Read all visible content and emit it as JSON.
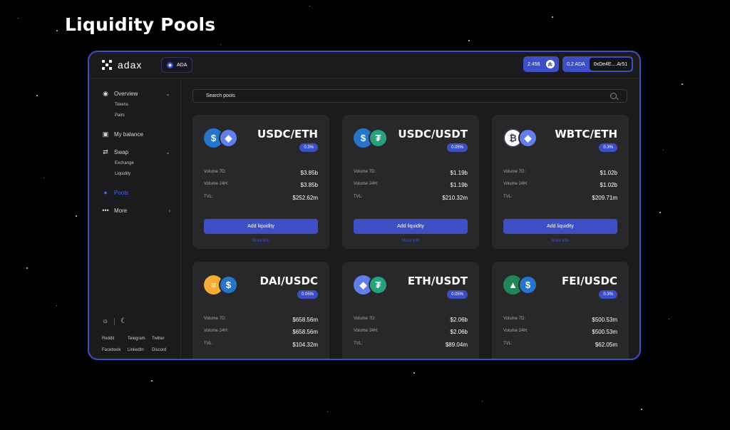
{
  "page": {
    "title": "Liquidity Pools"
  },
  "header": {
    "logo": "adax",
    "network_chip": "ADA",
    "balance": "2.456",
    "wallet_balance": "0.2 ADA",
    "wallet_address": "0xDe4E....Ar51"
  },
  "sidebar": {
    "overview": "Overview",
    "tokens": "Tokens",
    "pairs": "Pairs",
    "my_balance": "My balance",
    "swap": "Swap",
    "exchange": "Exchange",
    "liquidity": "Liquidity",
    "pools": "Pools",
    "more": "More",
    "social": {
      "reddit": "Reddit",
      "telegram": "Telegram",
      "twitter": "Twitter",
      "facebook": "Facebook",
      "linkedin": "LinkedIn",
      "discord": "Discord"
    }
  },
  "search": {
    "placeholder": "Search pools"
  },
  "labels": {
    "volume7d": "Volume 7D:",
    "volume24h": "Volume 24H:",
    "tvl": "TVL:",
    "add_liquidity": "Add liquidity",
    "more_info": "More info"
  },
  "pools": [
    {
      "pair": "USDC/ETH",
      "fee": "0.3%",
      "volume7d": "$3.85b",
      "volume24h": "$3.85b",
      "tvl": "$252.62m",
      "coin_a": "usdc-icon",
      "coin_b": "eth-icon"
    },
    {
      "pair": "USDC/USDT",
      "fee": "0.05%",
      "volume7d": "$1.19b",
      "volume24h": "$1.19b",
      "tvl": "$210.32m",
      "coin_a": "usdc-icon",
      "coin_b": "usdt-icon"
    },
    {
      "pair": "WBTC/ETH",
      "fee": "0.3%",
      "volume7d": "$1.02b",
      "volume24h": "$1.02b",
      "tvl": "$209.71m",
      "coin_a": "wbtc-icon",
      "coin_b": "eth-icon"
    },
    {
      "pair": "DAI/USDC",
      "fee": "0.05%",
      "volume7d": "$658.56m",
      "volume24h": "$658.56m",
      "tvl": "$104.32m",
      "coin_a": "dai-icon",
      "coin_b": "usdc-icon"
    },
    {
      "pair": "ETH/USDT",
      "fee": "0.05%",
      "volume7d": "$2.06b",
      "volume24h": "$2.06b",
      "tvl": "$89.04m",
      "coin_a": "eth-icon",
      "coin_b": "usdt-icon"
    },
    {
      "pair": "FEI/USDC",
      "fee": "0.3%",
      "volume7d": "$500.53m",
      "volume24h": "$500.53m",
      "tvl": "$62.05m",
      "coin_a": "fei-icon",
      "coin_b": "usdc-icon"
    }
  ],
  "colors": {
    "accent": "#3e4fc6",
    "card": "#28282b",
    "frame_bg": "#1b1b1d"
  }
}
